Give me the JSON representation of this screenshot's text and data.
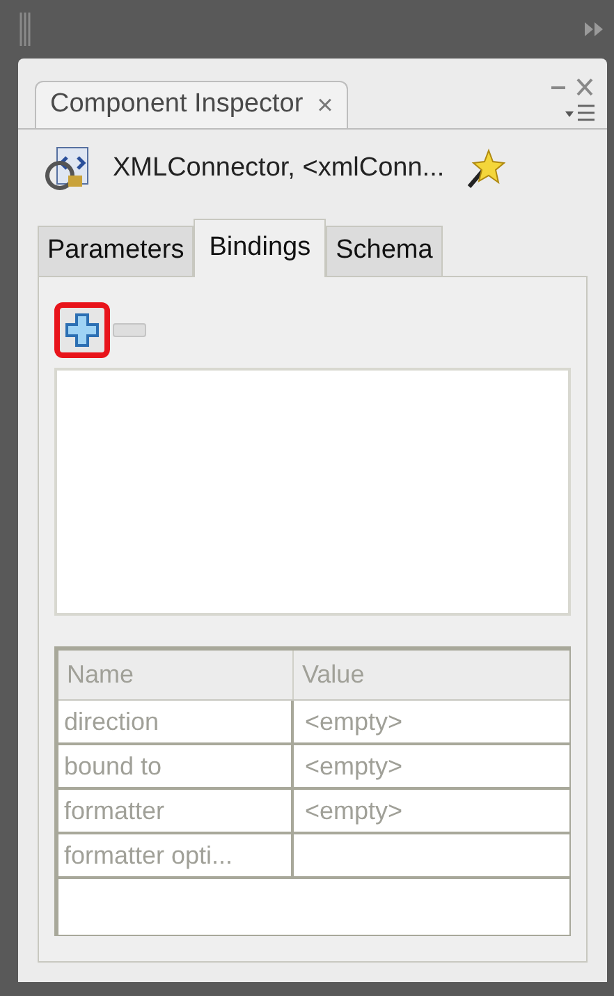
{
  "panel_tab": {
    "title": "Component Inspector",
    "close": "×"
  },
  "component": {
    "label": "XMLConnector, <xmlConn..."
  },
  "tabs": [
    {
      "label": "Parameters",
      "selected": false
    },
    {
      "label": "Bindings",
      "selected": true
    },
    {
      "label": "Schema",
      "selected": false
    }
  ],
  "toolbar": {
    "add": {
      "highlighted": true,
      "disabled": false
    },
    "remove": {
      "disabled": true
    }
  },
  "properties": {
    "disabled": true,
    "columns": [
      "Name",
      "Value"
    ],
    "rows": [
      [
        "direction",
        "<empty>"
      ],
      [
        "bound to",
        "<empty>"
      ],
      [
        "formatter",
        "<empty>"
      ],
      [
        "formatter opti..."
      ]
    ]
  }
}
